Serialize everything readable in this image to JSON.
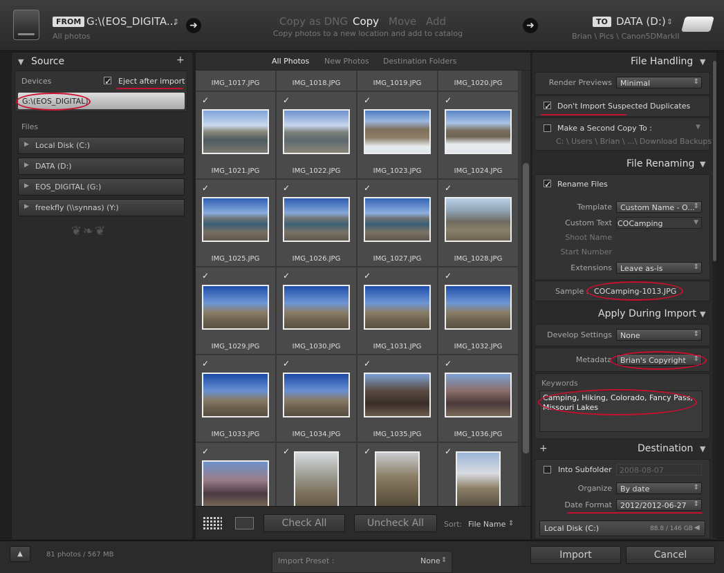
{
  "top": {
    "from_tag": "FROM",
    "from_path": "G:\\(EOS_DIGITA...",
    "from_sub": "All photos",
    "modes": [
      "Copy as DNG",
      "Copy",
      "Move",
      "Add"
    ],
    "mode_desc": "Copy photos to a new location and add to catalog",
    "to_tag": "TO",
    "to_path": "DATA (D:)",
    "to_sub": "Brian \\ Pics \\ Canon5DMarkII"
  },
  "source": {
    "title": "Source",
    "devices_label": "Devices",
    "eject_label": "Eject after import",
    "device_selected": "G:\\(EOS_DIGITAL)",
    "files_label": "Files",
    "drives": [
      "Local Disk (C:)",
      "DATA (D:)",
      "EOS_DIGITAL (G:)",
      "freekfly (\\\\synnas) (Y:)"
    ]
  },
  "center": {
    "tabs": [
      "All Photos",
      "New Photos",
      "Destination Folders"
    ],
    "top_row": [
      "IMG_1017.JPG",
      "IMG_1018.JPG",
      "IMG_1019.JPG",
      "IMG_1020.JPG"
    ],
    "rows": [
      [
        "IMG_1021.JPG",
        "IMG_1022.JPG",
        "IMG_1023.JPG",
        "IMG_1024.JPG"
      ],
      [
        "IMG_1025.JPG",
        "IMG_1026.JPG",
        "IMG_1027.JPG",
        "IMG_1028.JPG"
      ],
      [
        "IMG_1029.JPG",
        "IMG_1030.JPG",
        "IMG_1031.JPG",
        "IMG_1032.JPG"
      ],
      [
        "IMG_1033.JPG",
        "IMG_1034.JPG",
        "IMG_1035.JPG",
        "IMG_1036.JPG"
      ]
    ],
    "check_all": "Check All",
    "uncheck_all": "Uncheck All",
    "sort_label": "Sort:",
    "sort_value": "File Name"
  },
  "file_handling": {
    "title": "File Handling",
    "render_label": "Render Previews",
    "render_value": "Minimal",
    "dup_label": "Don't Import Suspected Duplicates",
    "second_copy_label": "Make a Second Copy To :",
    "second_copy_path": "C: \\ Users \\ Brian \\ ...\\ Download Backups"
  },
  "file_renaming": {
    "title": "File Renaming",
    "rename_label": "Rename Files",
    "template_label": "Template",
    "template_value": "Custom Name - O...",
    "custom_label": "Custom Text",
    "custom_value": "COCamping",
    "shoot_label": "Shoot Name",
    "start_label": "Start Number",
    "ext_label": "Extensions",
    "ext_value": "Leave as-is",
    "sample_label": "Sample :",
    "sample_value": "COCamping-1013.JPG"
  },
  "apply": {
    "title": "Apply During Import",
    "develop_label": "Develop Settings",
    "develop_value": "None",
    "metadata_label": "Metadata",
    "metadata_value": "Brian's Copyright",
    "keywords_label": "Keywords",
    "keywords_value": "Camping, Hiking, Colorado, Fancy Pass, Missouri Lakes"
  },
  "destination": {
    "title": "Destination",
    "subfolder_label": "Into Subfolder",
    "subfolder_value": "2008-08-07",
    "organize_label": "Organize",
    "organize_value": "By date",
    "date_label": "Date Format",
    "date_value": "2012/2012-06-27",
    "disk_label": "Local Disk (C:)",
    "disk_space": "88.8 / 146 GB"
  },
  "bottom": {
    "count": "81 photos / 567 MB",
    "preset_label": "Import Preset :",
    "preset_value": "None",
    "import": "Import",
    "cancel": "Cancel"
  }
}
